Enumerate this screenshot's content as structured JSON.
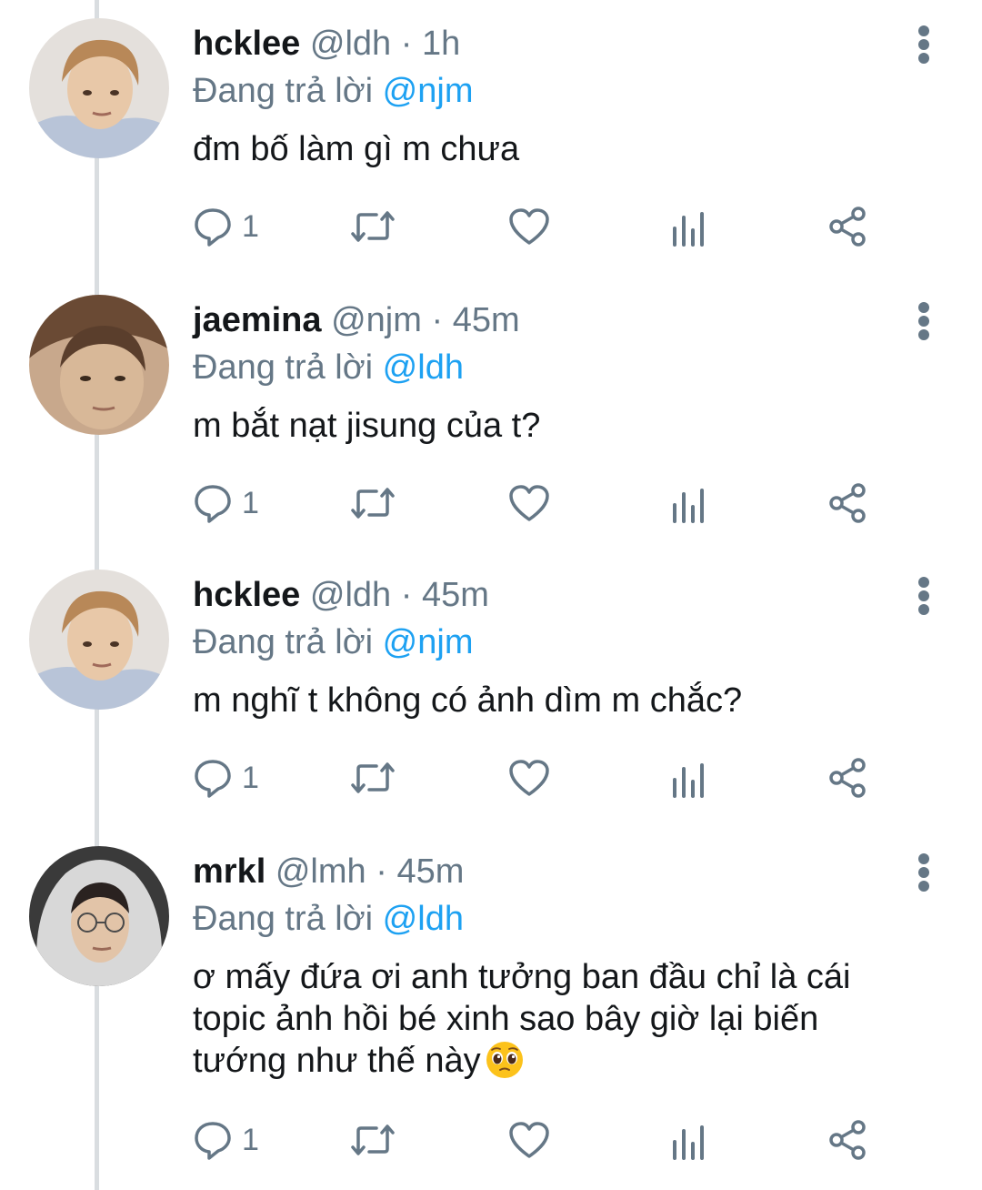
{
  "tweets": [
    {
      "name": "hcklee",
      "handle": "@ldh",
      "dot": "·",
      "time": "1h",
      "reply_prefix": "Đang trả lời",
      "reply_mention": "@njm",
      "text": "đm bố làm gì m chưa",
      "reply_count": "1",
      "avatar": "hcklee-avatar"
    },
    {
      "name": "jaemina",
      "handle": "@njm",
      "dot": "·",
      "time": "45m",
      "reply_prefix": "Đang trả lời",
      "reply_mention": "@ldh",
      "text": "m bắt nạt jisung của t?",
      "reply_count": "1",
      "avatar": "jaemina-avatar"
    },
    {
      "name": "hcklee",
      "handle": "@ldh",
      "dot": "·",
      "time": "45m",
      "reply_prefix": "Đang trả lời",
      "reply_mention": "@njm",
      "text": "m nghĩ t không có ảnh dìm m chắc?",
      "reply_count": "1",
      "avatar": "hcklee-avatar"
    },
    {
      "name": "mrkl",
      "handle": "@lmh",
      "dot": "·",
      "time": "45m",
      "reply_prefix": "Đang trả lời",
      "reply_mention": "@ldh",
      "text_lines": [
        "ơ mấy đứa ơi anh tưởng ban đầu chỉ là cái",
        "topic ảnh hồi bé xinh sao bây giờ lại biến",
        "tướng như thế này"
      ],
      "reply_count": "1",
      "avatar": "mrkl-avatar",
      "emoji": "pleading-face-emoji"
    }
  ],
  "icons": {
    "reply": "reply-icon",
    "retweet": "retweet-icon",
    "like": "heart-icon",
    "analytics": "analytics-icon",
    "share": "share-icon",
    "more": "more-vertical-icon"
  },
  "colors": {
    "accent": "#1da1f2",
    "secondary_text": "#657786",
    "thread_line": "#d9dde0"
  }
}
